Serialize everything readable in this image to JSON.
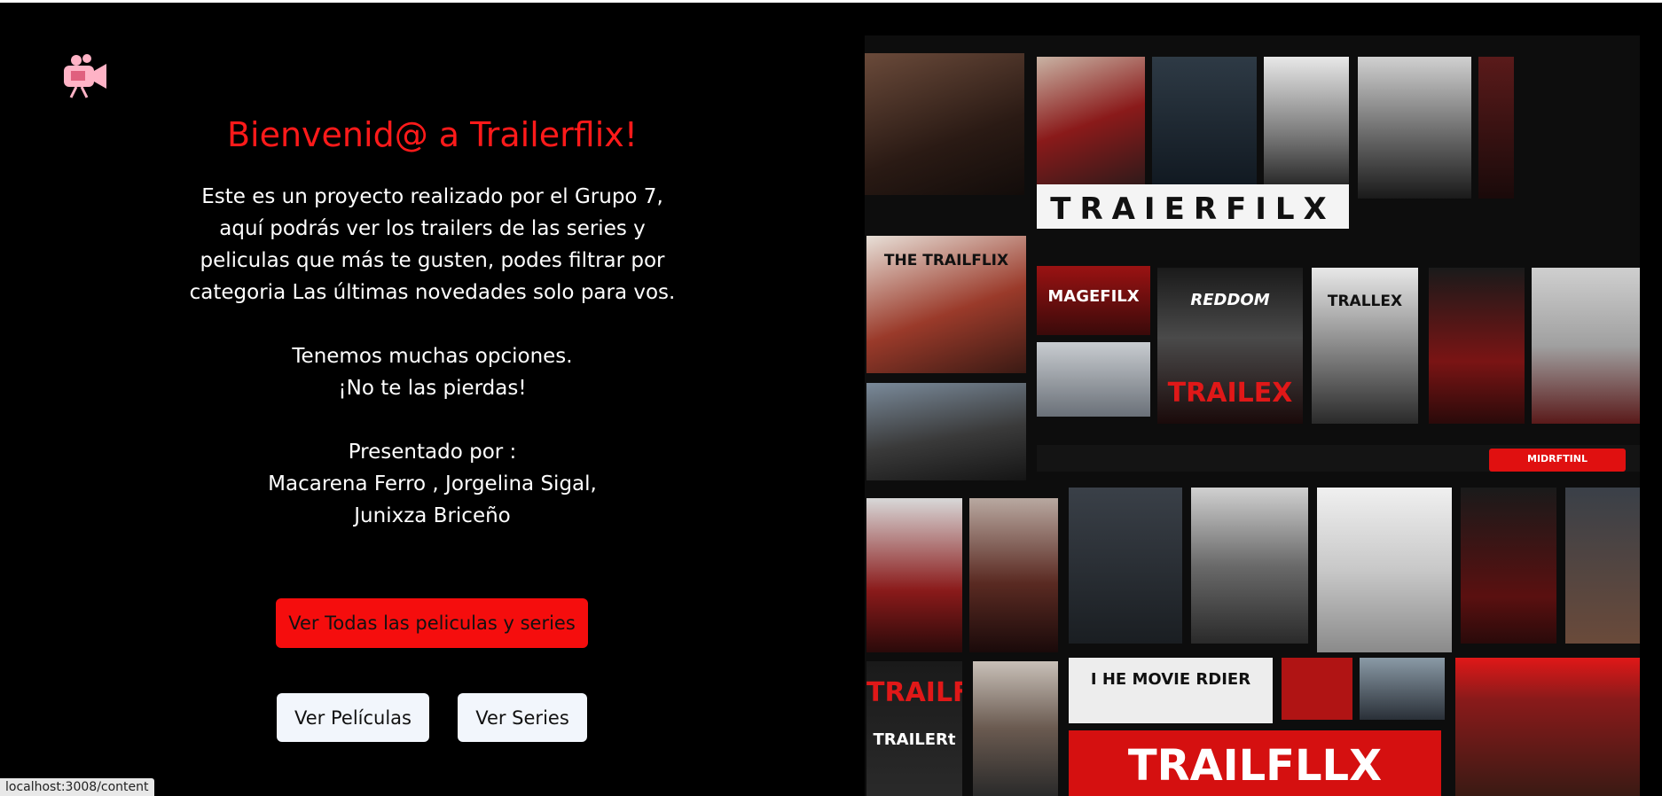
{
  "welcome": {
    "title": "Bienvenid@ a Trailerflix!",
    "intro_lines": [
      "Este es un proyecto realizado por el Grupo 7,",
      "aquí podrás ver los trailers de las series y",
      "peliculas que más te gusten, podes filtrar por",
      "categoria Las últimas novedades solo para vos."
    ],
    "options_lines": [
      "Tenemos muchas opciones.",
      "¡No te las pierdas!"
    ],
    "presented_lines": [
      "Presentado por :",
      "Macarena Ferro , Jorgelina Sigal,",
      "Junixza Briceño"
    ]
  },
  "buttons": {
    "all_label": "Ver Todas las peliculas y series",
    "movies_label": "Ver Películas",
    "series_label": "Ver Series"
  },
  "collage_texts": {
    "banner_top": "TRAIERFILX",
    "tile_trailflix": "THE TRAILFLIX",
    "tile_magefilix": "MAGEFILX",
    "tile_reddom": "REDDOM",
    "tile_trailex": "TRAILEX",
    "tile_tralle": "TRALLEX",
    "tile_monie": "I HE MOVIE RDIER",
    "tile_trailflix2": "TRAILFLIX",
    "tile_trailer": "TRAILERt",
    "banner_bottom": "TRAILFLLX",
    "nav_button": "MIDRFTINL"
  },
  "status_bar": {
    "url": "localhost:3008/content"
  },
  "colors": {
    "accent": "#f50d0d",
    "title": "#ff1a1a",
    "background": "#000000"
  },
  "icons": {
    "logo": "movie-camera-icon"
  }
}
